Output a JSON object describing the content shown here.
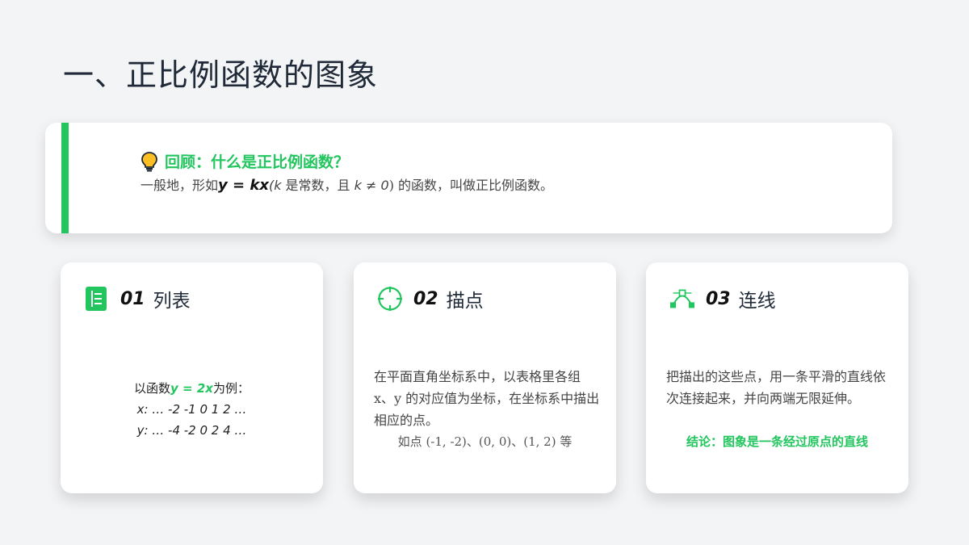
{
  "page": {
    "title": "一、正比例函数的图象"
  },
  "recall": {
    "heading": "回顾：什么是正比例函数？",
    "body_prefix": "一般地，形如",
    "body_formula": "y = kx",
    "body_mid1": "(",
    "body_k": "k",
    "body_mid2": " 是常数，且 ",
    "body_cond": "k ≠ 0",
    "body_suffix": ") 的函数，叫做正比例函数。",
    "icon": "lightbulb-icon",
    "accent_color": "#22c55e"
  },
  "cards": [
    {
      "number": "01",
      "label": "列表",
      "icon": "table-icon",
      "example_prefix": "以函数",
      "example_formula": "y = 2x",
      "example_suffix": "为例：",
      "row_x": "x: … -2 -1 0 1 2 …",
      "row_y": "y: … -4 -2 0 2 4 …"
    },
    {
      "number": "02",
      "label": "描点",
      "icon": "crosshair-icon",
      "desc": "在平面直角坐标系中，以表格里各组 x、y 的对应值为坐标，在坐标系中描出相应的点。",
      "note": "如点 (-1, -2)、(0, 0)、(1, 2) 等"
    },
    {
      "number": "03",
      "label": "连线",
      "icon": "bezier-curve-icon",
      "desc": "把描出的这些点，用一条平滑的直线依次连接起来，并向两端无限延伸。",
      "conclusion": "结论：图象是一条经过原点的直线"
    }
  ]
}
